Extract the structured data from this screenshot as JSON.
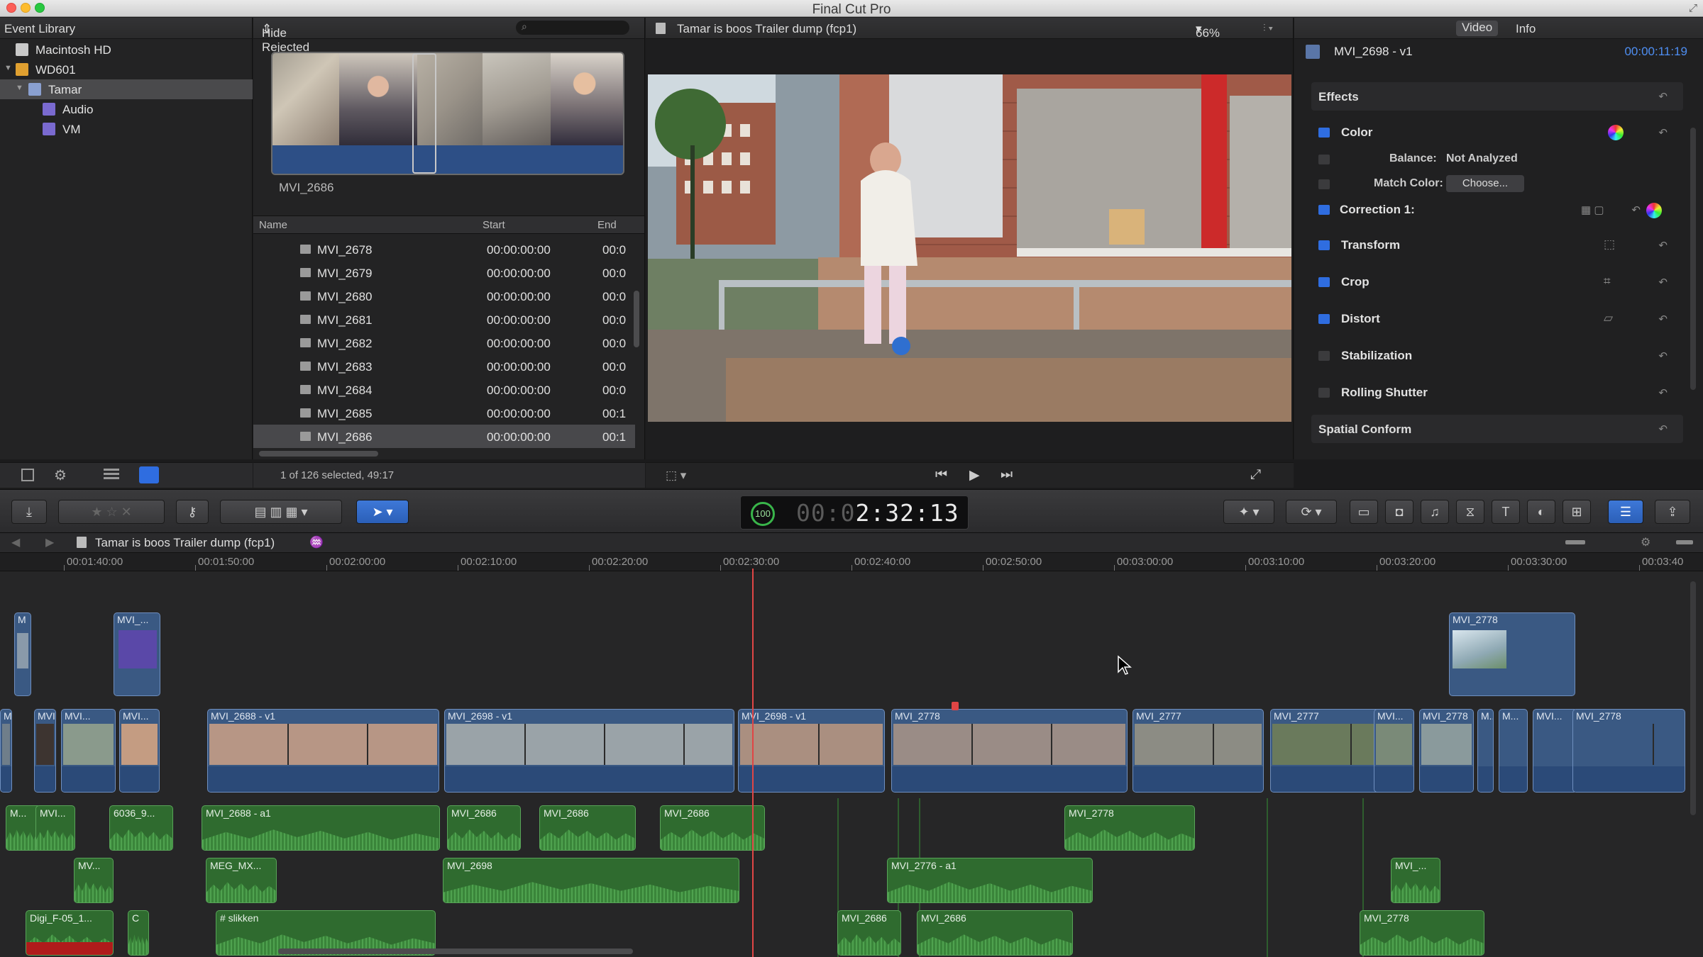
{
  "window": {
    "title": "Final Cut Pro"
  },
  "library": {
    "header": "Event Library",
    "items": [
      {
        "label": "Macintosh HD",
        "level": 0,
        "icon": "hard-drive-icon",
        "expanded": null
      },
      {
        "label": "WD601",
        "level": 0,
        "icon": "hard-drive-icon",
        "expanded": true
      },
      {
        "label": "Tamar",
        "level": 1,
        "icon": "event-icon",
        "expanded": true,
        "selected": true
      },
      {
        "label": "Audio",
        "level": 2,
        "icon": "keyword-icon",
        "expanded": null
      },
      {
        "label": "VM",
        "level": 2,
        "icon": "keyword-icon",
        "expanded": null
      }
    ]
  },
  "browser": {
    "filter": "Hide Rejected",
    "filmstrip_label": "MVI_2686",
    "columns": {
      "name": "Name",
      "start": "Start",
      "end": "End"
    },
    "rows": [
      {
        "name": "MVI_2678",
        "start": "00:00:00:00",
        "end": "00:0"
      },
      {
        "name": "MVI_2679",
        "start": "00:00:00:00",
        "end": "00:0"
      },
      {
        "name": "MVI_2680",
        "start": "00:00:00:00",
        "end": "00:0"
      },
      {
        "name": "MVI_2681",
        "start": "00:00:00:00",
        "end": "00:0"
      },
      {
        "name": "MVI_2682",
        "start": "00:00:00:00",
        "end": "00:0"
      },
      {
        "name": "MVI_2683",
        "start": "00:00:00:00",
        "end": "00:0"
      },
      {
        "name": "MVI_2684",
        "start": "00:00:00:00",
        "end": "00:0"
      },
      {
        "name": "MVI_2685",
        "start": "00:00:00:00",
        "end": "00:1"
      },
      {
        "name": "MVI_2686",
        "start": "00:00:00:00",
        "end": "00:1",
        "selected": true
      }
    ],
    "status": "1 of 126 selected, 49:17"
  },
  "viewer": {
    "title": "Tamar is boos Trailer dump (fcp1)",
    "zoom": "66%"
  },
  "inspector": {
    "tabs": [
      "Video",
      "Info"
    ],
    "clip_name": "MVI_2698 - v1",
    "clip_duration": "00:00:11:19",
    "sections": {
      "effects": "Effects",
      "color": "Color",
      "balance_label": "Balance:",
      "balance_value": "Not Analyzed",
      "match_label": "Match Color:",
      "match_button": "Choose...",
      "correction": "Correction 1:",
      "transform": "Transform",
      "crop": "Crop",
      "distort": "Distort",
      "stabilization": "Stabilization",
      "rolling_shutter": "Rolling Shutter",
      "spatial_conform": "Spatial Conform"
    }
  },
  "dashboard": {
    "progress_pct": "100",
    "timecode_dim": "00:0",
    "timecode": "2:32:13"
  },
  "timeline": {
    "project": "Tamar is boos Trailer dump (fcp1)",
    "ruler": [
      "00:01:40:00",
      "00:01:50:00",
      "00:02:00:00",
      "00:02:10:00",
      "00:02:20:00",
      "00:02:30:00",
      "00:02:40:00",
      "00:02:50:00",
      "00:03:00:00",
      "00:03:10:00",
      "00:03:20:00",
      "00:03:30:00",
      "00:03:40"
    ],
    "connected_video": [
      {
        "name": "M"
      },
      {
        "name": "MVI_..."
      },
      {
        "name": "MVI_2778"
      }
    ],
    "primary": [
      {
        "name": "M..."
      },
      {
        "name": "MVI..."
      },
      {
        "name": "MVI..."
      },
      {
        "name": "MVI..."
      },
      {
        "name": "MVI_2688 - v1"
      },
      {
        "name": "MVI_2698 - v1"
      },
      {
        "name": "MVI_2698 - v1"
      },
      {
        "name": "MVI_2778"
      },
      {
        "name": "MVI_2777"
      },
      {
        "name": "MVI_2777"
      },
      {
        "name": "MVI..."
      },
      {
        "name": "MVI_2778"
      },
      {
        "name": "M..."
      },
      {
        "name": "M..."
      },
      {
        "name": "MVI..."
      },
      {
        "name": "MVI_2778"
      }
    ],
    "audio": [
      {
        "name": "M..."
      },
      {
        "name": "MVI..."
      },
      {
        "name": "6036_9..."
      },
      {
        "name": "MVI_2688 - a1"
      },
      {
        "name": "MVI_2686"
      },
      {
        "name": "MVI_2686"
      },
      {
        "name": "MVI_2686"
      },
      {
        "name": "MVI_2778"
      },
      {
        "name": "MV..."
      },
      {
        "name": "MEG_MX..."
      },
      {
        "name": "MVI_2698"
      },
      {
        "name": "MVI_2776 - a1"
      },
      {
        "name": "MVI_..."
      },
      {
        "name": "Digi_F-05_1..."
      },
      {
        "name": "C"
      },
      {
        "name": "# slikken"
      },
      {
        "name": "MVI_2686"
      },
      {
        "name": "MVI_2686"
      },
      {
        "name": "MVI_2778"
      }
    ]
  }
}
